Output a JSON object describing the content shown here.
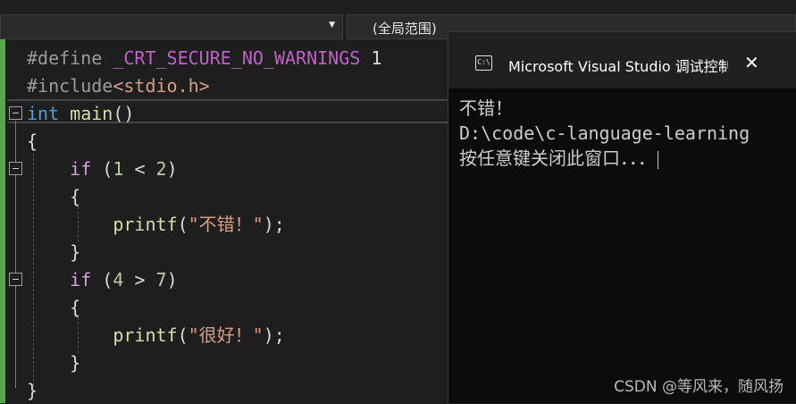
{
  "toolbar": {
    "scope_label": "(全局范围)"
  },
  "editor": {
    "line1": {
      "directive": "#define",
      "macro": "_CRT_SECURE_NO_WARNINGS",
      "value": "1"
    },
    "line2": {
      "directive": "#include",
      "header": "<stdio.h>"
    },
    "line3": {
      "type": "int",
      "name": "main",
      "parens": "()"
    },
    "line4": "{",
    "line5": {
      "kw": "if",
      "open": " (",
      "a": "1",
      "op": " < ",
      "b": "2",
      "close": ")"
    },
    "line6": "{",
    "line7": {
      "fn": "printf",
      "open": "(",
      "str": "\"不错！\"",
      "close": ");"
    },
    "line8": "}",
    "line9": {
      "kw": "if",
      "open": " (",
      "a": "4",
      "op": " > ",
      "b": "7",
      "close": ")"
    },
    "line10": "{",
    "line11": {
      "fn": "printf",
      "open": "(",
      "str": "\"很好！\"",
      "close": ");"
    },
    "line12": "}",
    "line13": "}"
  },
  "console": {
    "icon_text": "C:\\",
    "title": "Microsoft Visual Studio 调试控制台",
    "close": "✕",
    "lines": [
      "不错！",
      "D:\\code\\c-language-learning",
      "按任意键关闭此窗口．．．"
    ]
  },
  "watermark": "CSDN @等风来，随风扬"
}
